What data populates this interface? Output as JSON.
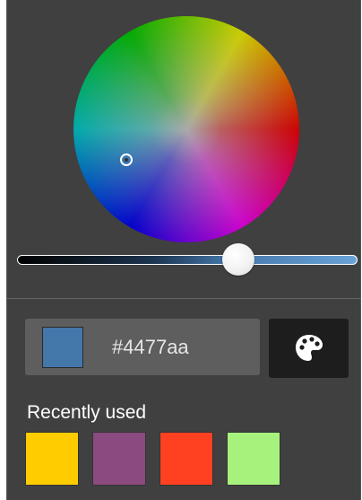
{
  "color_picker": {
    "selected_color": "#4477aa",
    "hex_prefix": "#",
    "hex_value": "4477aa",
    "brightness_level": 0.66,
    "palette_icon": "palette-icon"
  },
  "recently_used": {
    "label": "Recently used",
    "colors": [
      "#ffcc00",
      "#8b4a80",
      "#ff4122",
      "#a7f27d"
    ]
  }
}
